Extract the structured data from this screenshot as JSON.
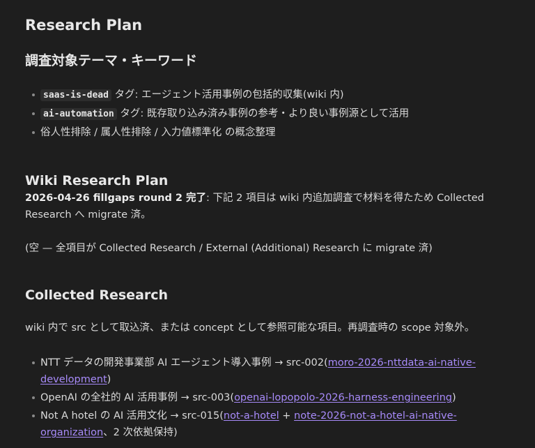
{
  "title": "Research Plan",
  "keywords_section": {
    "heading": "調査対象テーマ・キーワード",
    "items": [
      {
        "code": "saas-is-dead",
        "text": " タグ: エージェント活用事例の包括的収集(wiki 内)"
      },
      {
        "code": "ai-automation",
        "text": " タグ: 既存取り込み済み事例の参考・より良い事例源として活用"
      },
      {
        "text": "俗人性排除 / 属人性排除 / 入力値標準化 の概念整理"
      }
    ]
  },
  "wiki_section": {
    "heading": "Wiki Research Plan",
    "note_bold": "2026-04-26 fillgaps round 2 完了",
    "note_rest": ": 下記 2 項目は wiki 内追加調査で材料を得たため Collected Research へ migrate 済。",
    "empty_note": "(空 — 全項目が Collected Research / External (Additional) Research に migrate 済)"
  },
  "collected_section": {
    "heading": "Collected Research",
    "intro": "wiki 内で src として取込済、または concept として参照可能な項目。再調査時の scope 対象外。",
    "items": [
      {
        "text": "NTT データの開発事業部 AI エージェント導入事例 → src-002(",
        "link1": "moro-2026-nttdata-ai-native-development",
        "sep": "",
        "link2": "",
        "tail": ")"
      },
      {
        "text": "OpenAI の全社的 AI 活用事例 → src-003(",
        "link1": "openai-lopopolo-2026-harness-engineering",
        "sep": "",
        "link2": "",
        "tail": ")"
      },
      {
        "text": "Not A hotel の AI 活用文化 → src-015(",
        "link1": "not-a-hotel",
        "sep": " + ",
        "link2": "note-2026-not-a-hotel-ai-native-organization",
        "tail": "、2 次依拠保持)"
      }
    ]
  }
}
